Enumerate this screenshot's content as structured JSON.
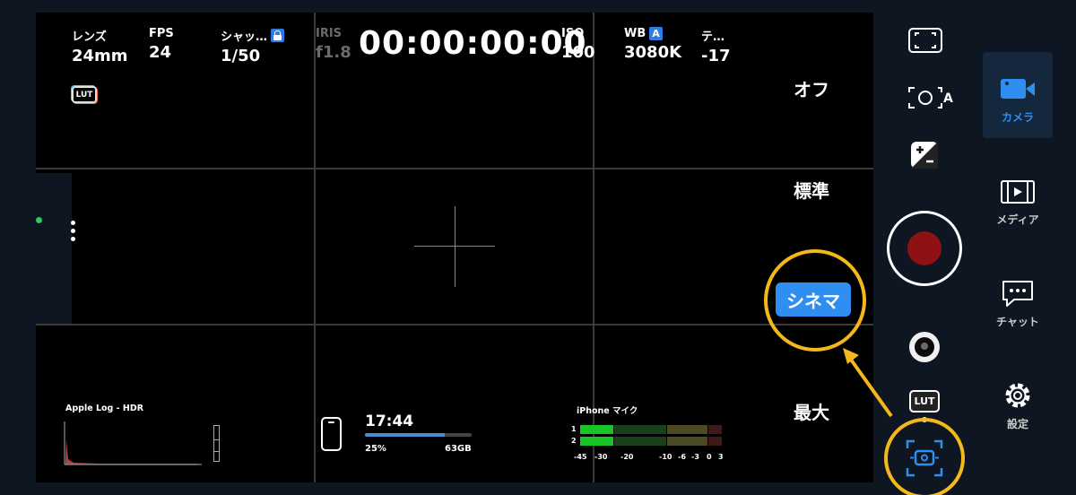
{
  "params": {
    "lens": {
      "label": "レンズ",
      "value": "24mm"
    },
    "fps": {
      "label": "FPS",
      "value": "24"
    },
    "shutter": {
      "label": "シャッ…",
      "value": "1/50"
    },
    "iris": {
      "label": "IRIS",
      "value": "f1.8"
    },
    "iso": {
      "label": "ISO",
      "value": "100"
    },
    "wb": {
      "label": "WB",
      "badge": "A",
      "value": "3080K"
    },
    "tint": {
      "label": "テ…",
      "value": "-17"
    }
  },
  "timecode": "00:00:00:00",
  "lut_badge": "LUT",
  "stabilization_options": {
    "off": "オフ",
    "standard": "標準",
    "cinematic": "シネマ",
    "max": "最大",
    "selected": "cinematic"
  },
  "histogram": {
    "label": "Apple Log - HDR"
  },
  "status": {
    "clock": "17:44",
    "battery_percent_label": "25%",
    "battery_level": 0.75,
    "storage": "63GB"
  },
  "audio": {
    "label": "iPhone マイク",
    "channels": [
      "1",
      "2"
    ],
    "scale": [
      "-45",
      "-30",
      "-20",
      "-10",
      "-6",
      "-3",
      "0",
      "3"
    ]
  },
  "controls": {
    "right_column_icons": [
      "frame-guides-icon",
      "auto-exposure-icon",
      "exposure-compensation-icon",
      "record-button",
      "lens-selector",
      "lut-button",
      "stabilization-icon"
    ],
    "auto_exposure_badge": "A",
    "lut_button_label": "LUT",
    "record_color": "#8e1214"
  },
  "nav": [
    {
      "label": "カメラ",
      "icon": "video-camera-icon",
      "active": true
    },
    {
      "label": "メディア",
      "icon": "film-icon",
      "active": false
    },
    {
      "label": "チャット",
      "icon": "chat-icon",
      "active": false
    },
    {
      "label": "設定",
      "icon": "gear-icon",
      "active": false
    }
  ],
  "colors": {
    "accent": "#2f8ff0",
    "highlight": "#f5b81c",
    "background": "#0d1621"
  }
}
